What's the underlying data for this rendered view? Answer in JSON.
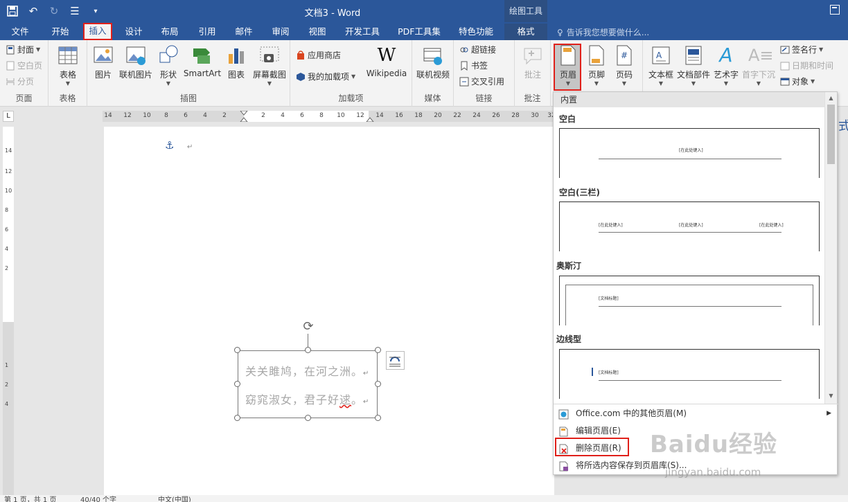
{
  "window": {
    "title": "文档3 - Word",
    "context_tab_group": "绘图工具",
    "tell_me": "告诉我您想要做什么..."
  },
  "tabs": [
    {
      "label": "文件"
    },
    {
      "label": "开始"
    },
    {
      "label": "插入",
      "active": true
    },
    {
      "label": "设计"
    },
    {
      "label": "布局"
    },
    {
      "label": "引用"
    },
    {
      "label": "邮件"
    },
    {
      "label": "审阅"
    },
    {
      "label": "视图"
    },
    {
      "label": "开发工具"
    },
    {
      "label": "PDF工具集"
    },
    {
      "label": "特色功能"
    },
    {
      "label": "格式"
    }
  ],
  "ribbon": {
    "pages": {
      "label": "页面",
      "cover": "封面",
      "blank_page": "空白页",
      "page_break": "分页"
    },
    "tables": {
      "label": "表格",
      "table": "表格"
    },
    "illustrations": {
      "label": "插图",
      "picture": "图片",
      "online_picture": "联机图片",
      "shapes": "形状",
      "smartart": "SmartArt",
      "chart": "图表",
      "screenshot": "屏幕截图"
    },
    "addins": {
      "label": "加载项",
      "store": "应用商店",
      "my_addins": "我的加载项",
      "wikipedia": "Wikipedia"
    },
    "media": {
      "label": "媒体",
      "online_video": "联机视频"
    },
    "links": {
      "label": "链接",
      "hyperlink": "超链接",
      "bookmark": "书签",
      "cross_ref": "交叉引用"
    },
    "comments": {
      "label": "批注",
      "comment": "批注"
    },
    "header_footer": {
      "header": "页眉",
      "footer": "页脚",
      "page_number": "页码"
    },
    "text": {
      "textbox": "文本框",
      "quick_parts": "文档部件",
      "wordart": "艺术字",
      "dropcap": "首字下沉",
      "signature": "签名行",
      "datetime": "日期和时间",
      "object": "对象"
    }
  },
  "ruler": {
    "h_numbers": [
      "14",
      "12",
      "10",
      "8",
      "6",
      "4",
      "2",
      "2",
      "4",
      "6",
      "8",
      "10",
      "12",
      "14",
      "16",
      "18",
      "20",
      "22",
      "24",
      "26",
      "28",
      "30",
      "32"
    ],
    "v_numbers": [
      "14",
      "12",
      "10",
      "8",
      "6",
      "4",
      "2",
      "1",
      "2",
      "4"
    ]
  },
  "document": {
    "textbox_line1": "关关雎鸠，在河之洲。",
    "textbox_line2_pre": "窈窕淑女，君子好",
    "textbox_line2_err": "逑",
    "textbox_line2_post": "。",
    "para_mark": "↵"
  },
  "gallery": {
    "section": "内置",
    "items": [
      {
        "title": "空白",
        "placeholders": [
          "[在此处键入]"
        ]
      },
      {
        "title": "空白(三栏)",
        "placeholders": [
          "[在此处键入]",
          "[在此处键入]",
          "[在此处键入]"
        ]
      },
      {
        "title": "奥斯汀",
        "placeholders": [
          "[文档标题]"
        ]
      },
      {
        "title": "边线型",
        "placeholders": [
          "[文档标题]"
        ]
      }
    ],
    "menu": [
      {
        "label": "Office.com 中的其他页眉(M)",
        "has_submenu": true
      },
      {
        "label": "编辑页眉(E)",
        "has_submenu": false
      },
      {
        "label": "删除页眉(R)",
        "has_submenu": false,
        "highlighted": true
      },
      {
        "label": "将所选内容保存到页眉库(S)...",
        "has_submenu": false
      }
    ]
  },
  "statusbar": {
    "page": "第 1 页，共 1 页",
    "words": "40/40 个字",
    "language": "中文(中国)"
  },
  "watermark": {
    "main": "Baidu经验",
    "sub": "jingyan.baidu.com"
  },
  "side_fragment": "式",
  "colors": {
    "accent": "#2b579a",
    "highlight": "#e0201a",
    "ribbon_bg": "#f3f3f3"
  }
}
